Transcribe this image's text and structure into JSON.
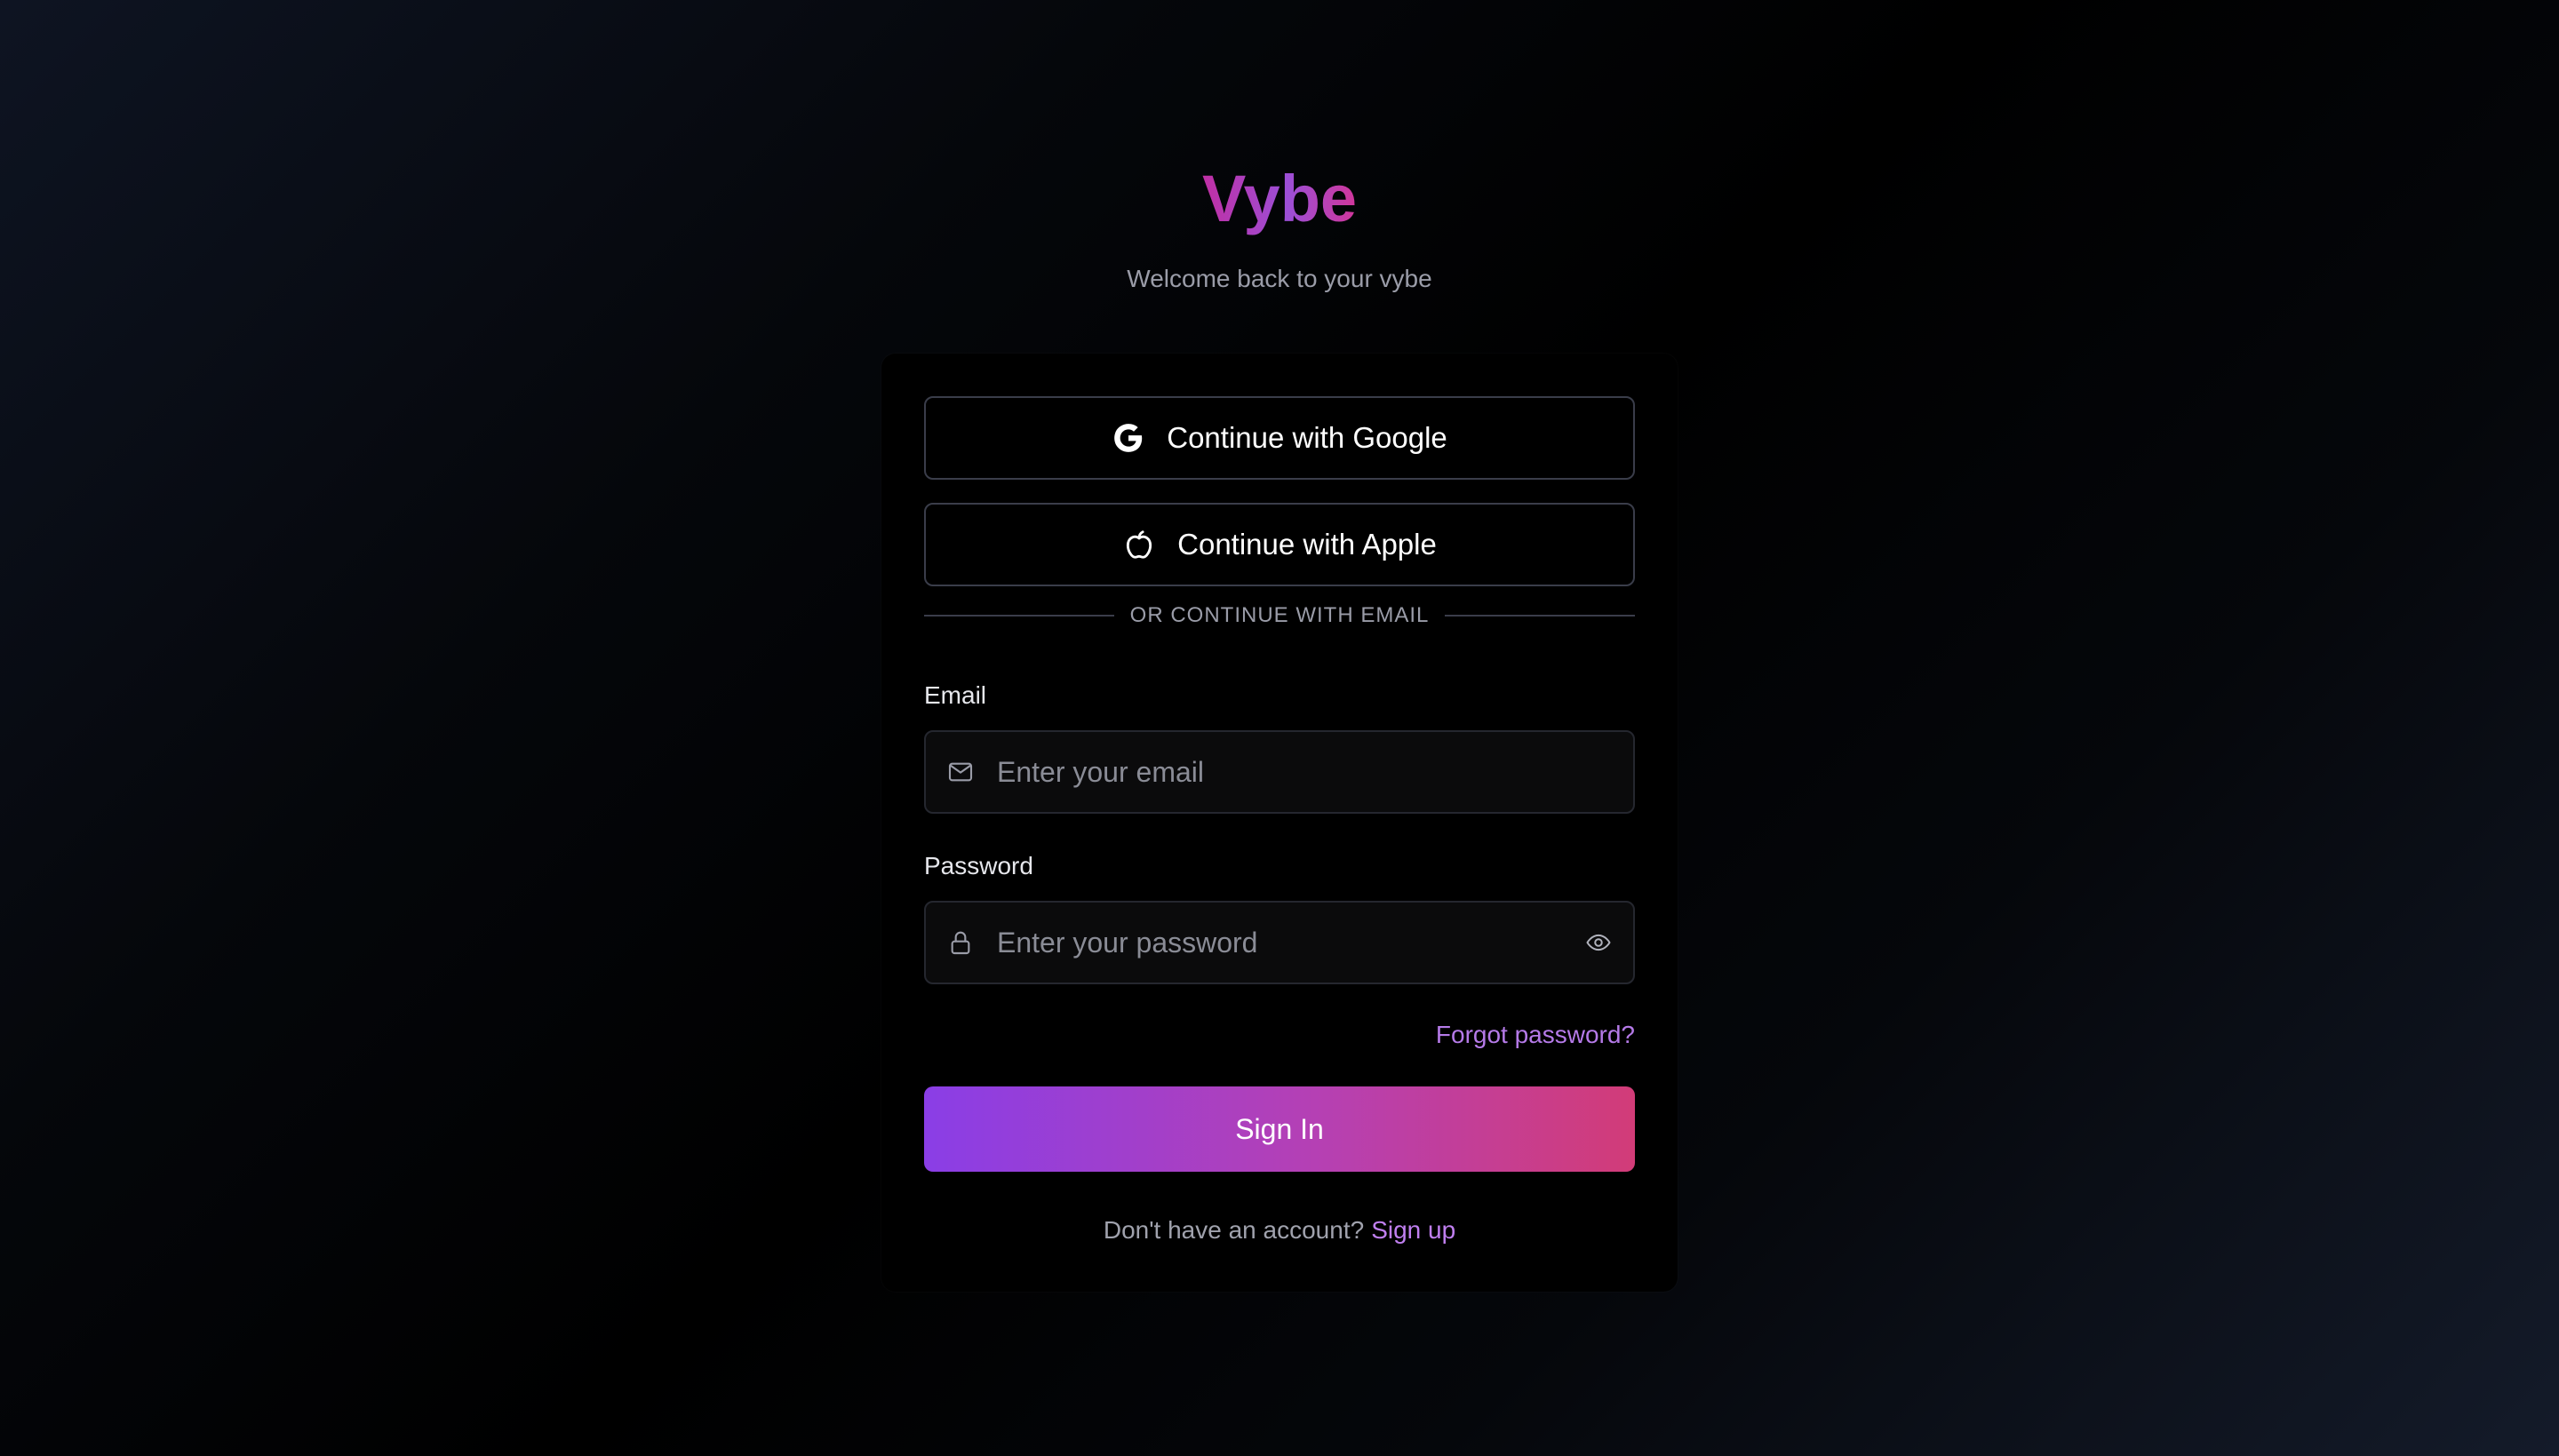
{
  "brand": {
    "name": "Vybe",
    "tagline": "Welcome back to your vybe"
  },
  "social": {
    "google_label": "Continue with Google",
    "google_icon": "google-icon",
    "apple_label": "Continue with Apple",
    "apple_icon": "apple-icon"
  },
  "divider": {
    "text": "OR CONTINUE WITH EMAIL"
  },
  "email": {
    "label": "Email",
    "placeholder": "Enter your email",
    "value": "",
    "icon": "mail-icon"
  },
  "password": {
    "label": "Password",
    "placeholder": "Enter your password",
    "value": "",
    "icon": "lock-icon",
    "toggle_icon": "eye-icon"
  },
  "links": {
    "forgot": "Forgot password?",
    "signup_prompt": "Don't have an account?",
    "signup": "Sign up"
  },
  "actions": {
    "signin_label": "Sign In"
  },
  "colors": {
    "accent_start": "#8a3ee6",
    "accent_end": "#d23c78",
    "link": "#b57ae8",
    "card_bg": "#000000"
  }
}
